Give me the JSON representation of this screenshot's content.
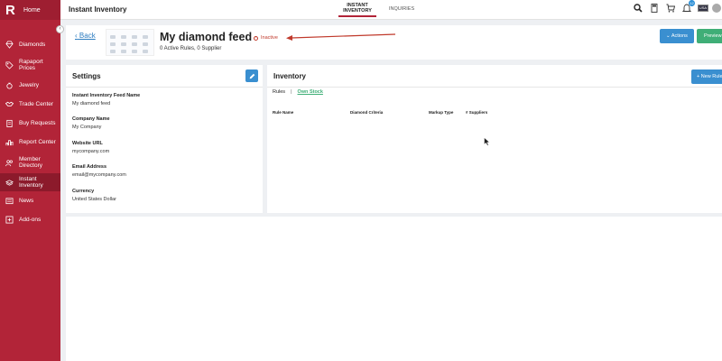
{
  "sidebar": {
    "logo": "R",
    "home": "Home",
    "items": [
      {
        "label": "Diamonds",
        "icon": "diamond-icon"
      },
      {
        "label": "Rapaport Prices",
        "icon": "price-tag-icon"
      },
      {
        "label": "Jewelry",
        "icon": "ring-icon"
      },
      {
        "label": "Trade Center",
        "icon": "handshake-icon"
      },
      {
        "label": "Buy Requests",
        "icon": "clipboard-icon"
      },
      {
        "label": "Report Center",
        "icon": "bar-chart-icon"
      },
      {
        "label": "Member Directory",
        "icon": "people-icon"
      },
      {
        "label": "Instant Inventory",
        "icon": "layers-icon",
        "active": true
      },
      {
        "label": "News",
        "icon": "newspaper-icon"
      },
      {
        "label": "Add-ons",
        "icon": "plus-box-icon"
      }
    ]
  },
  "topbar": {
    "title": "Instant Inventory",
    "tabs": [
      {
        "label": "INSTANT INVENTORY",
        "active": true
      },
      {
        "label": "INQUIRIES",
        "active": false
      }
    ],
    "notification_count": "12",
    "flag_text": "USA"
  },
  "header": {
    "back_label": "Back",
    "feed_title": "My diamond feed",
    "status": "Inactive",
    "subtitle": "0 Active Rules, 0 Supplier",
    "actions_label": "Actions",
    "preview_label": "Preview"
  },
  "settings": {
    "title": "Settings",
    "fields": [
      {
        "label": "Instant Inventory Feed Name",
        "value": "My diamond feed"
      },
      {
        "label": "Company Name",
        "value": "My Company"
      },
      {
        "label": "Website URL",
        "value": "mycompany.com"
      },
      {
        "label": "Email Address",
        "value": "email@mycompany.com"
      },
      {
        "label": "Currency",
        "value": "United States Dollar"
      }
    ]
  },
  "inventory": {
    "title": "Inventory",
    "new_rule_label": "+ New Rule",
    "subtabs": [
      {
        "label": "Rules"
      },
      {
        "label": "Own Stock"
      }
    ],
    "columns": [
      "Rule Name",
      "Diamond Criteria",
      "Markup Type",
      "# Suppliers"
    ]
  },
  "colors": {
    "brand": "#b22438",
    "primary": "#3a8fd0",
    "success": "#3fae77",
    "danger": "#c0392b"
  }
}
